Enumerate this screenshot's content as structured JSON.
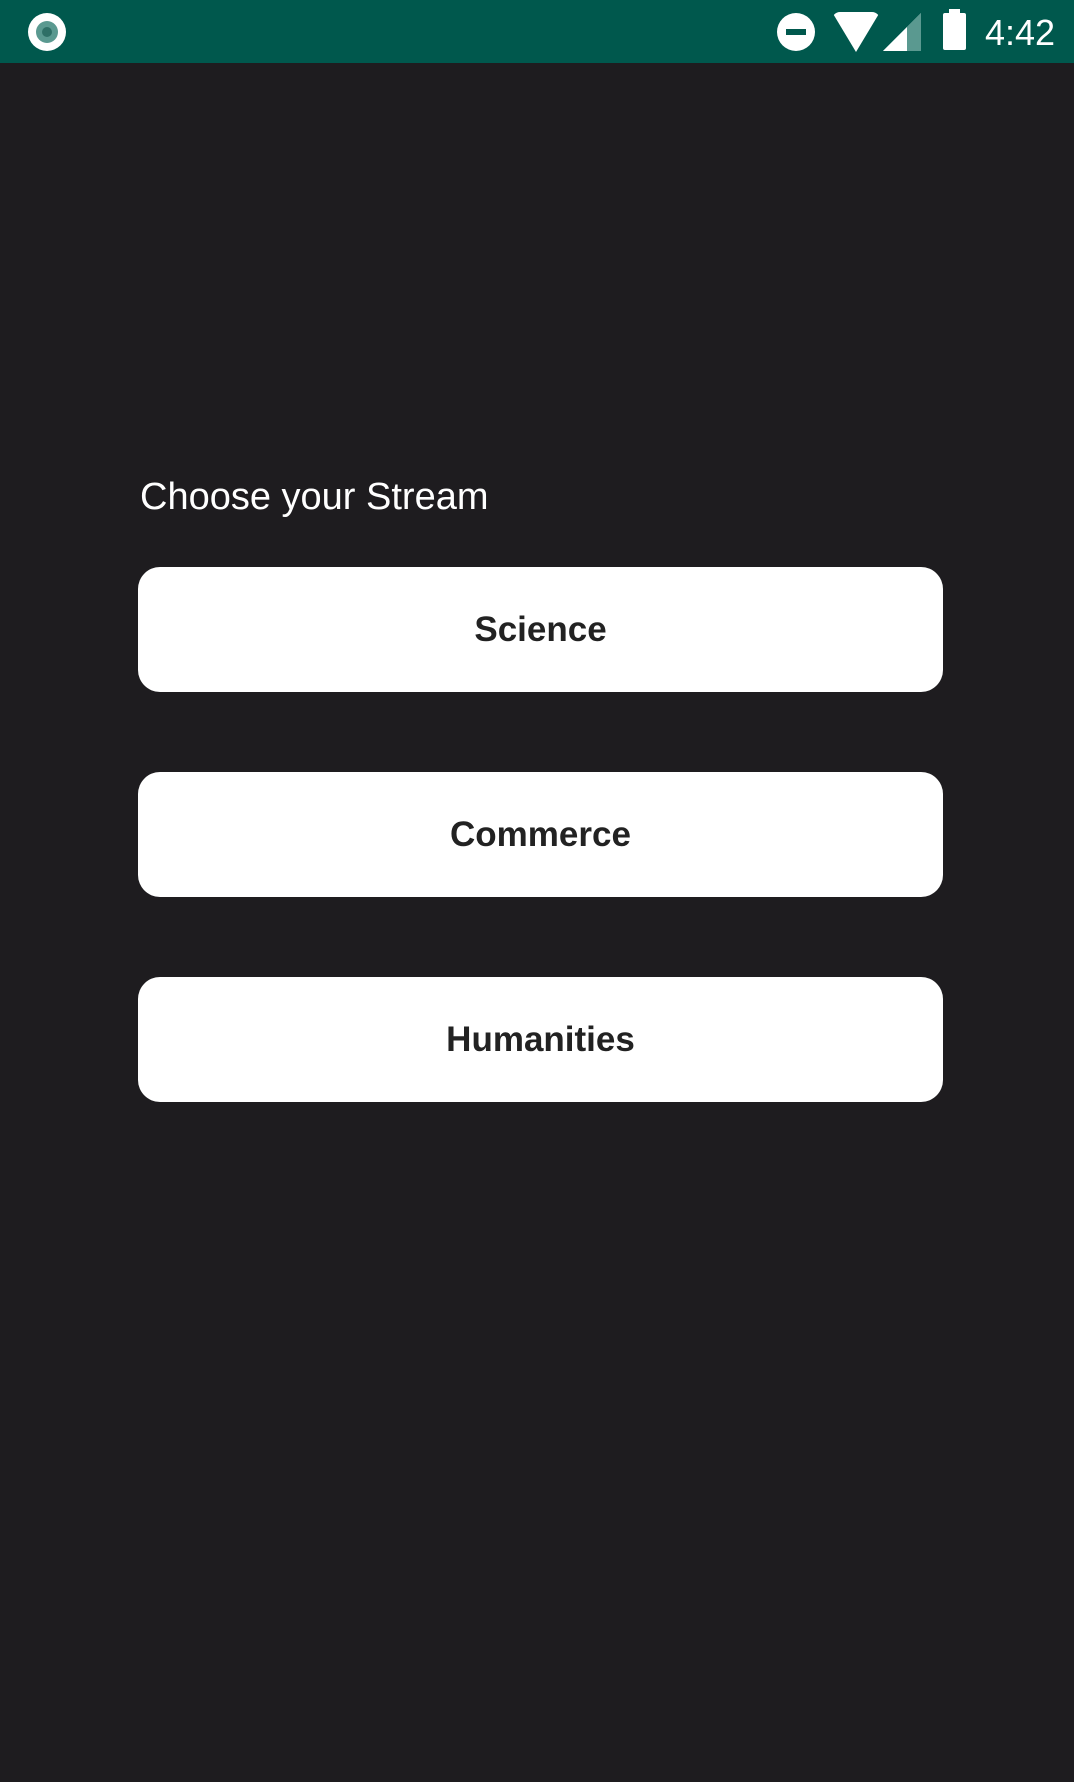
{
  "status_bar": {
    "time": "4:42",
    "icons": [
      "app-notification-icon",
      "do-not-disturb-icon",
      "wifi-icon",
      "cell-signal-icon",
      "battery-icon"
    ]
  },
  "main": {
    "title": "Choose your Stream",
    "options": [
      {
        "label": "Science"
      },
      {
        "label": "Commerce"
      },
      {
        "label": "Humanities"
      }
    ]
  },
  "colors": {
    "status_bar": "#00584d",
    "background": "#1e1c1f",
    "button": "#ffffff"
  }
}
